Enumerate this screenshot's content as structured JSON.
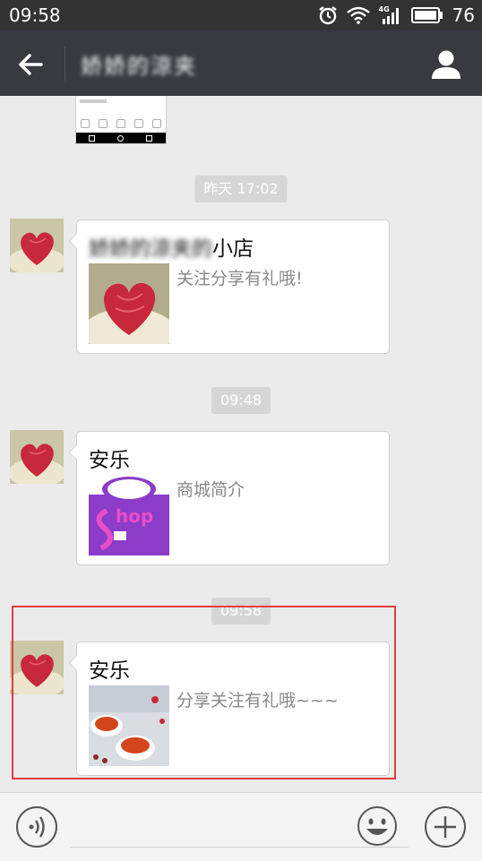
{
  "status_bar": {
    "time": "09:58",
    "network": "4G",
    "battery": "76"
  },
  "header": {
    "title": "娇娇的涼夹"
  },
  "chat": {
    "timestamps": [
      "昨天 17:02",
      "09:48",
      "09:58"
    ],
    "messages": [
      {
        "title_blurred": "娇娇的涼夹的",
        "title_clear": "小店",
        "description": "关注分享有礼哦!",
        "thumb": "heart-cake-image"
      },
      {
        "title_blurred": "",
        "title_clear": "安乐",
        "description": "商城简介",
        "thumb": "shop-bag-image",
        "thumb_text": "hop"
      },
      {
        "title_blurred": "",
        "title_clear": "安乐",
        "description": "分享关注有礼哦~~~",
        "thumb": "tea-cups-image"
      }
    ]
  },
  "colors": {
    "title_bar": "#393a3f",
    "status_bar": "#333333",
    "chat_bg": "#ebebeb",
    "highlight": "#e53b3b"
  }
}
